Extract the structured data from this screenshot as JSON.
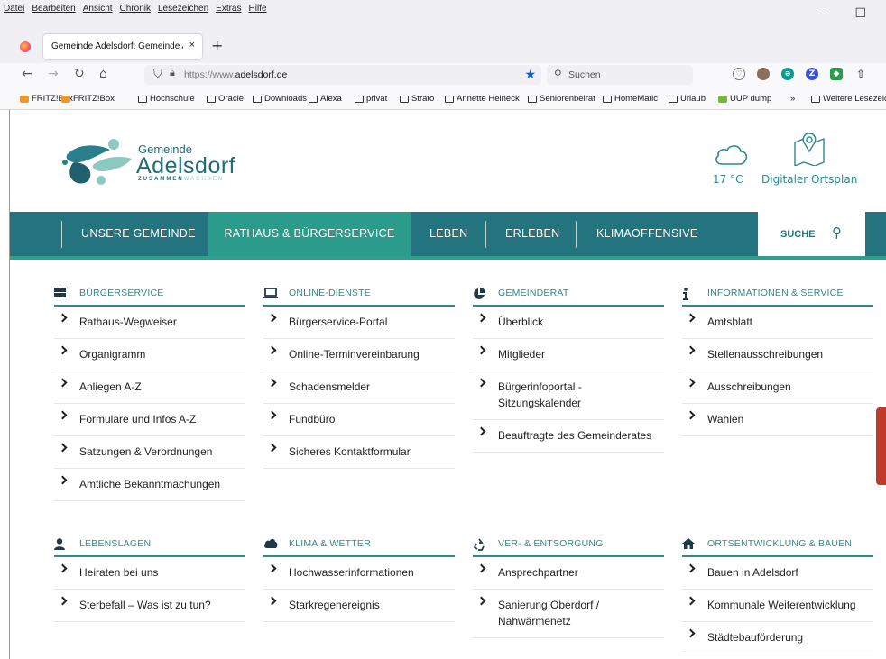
{
  "browser": {
    "menu": [
      "Datei",
      "Bearbeiten",
      "Ansicht",
      "Chronik",
      "Lesezeichen",
      "Extras",
      "Hilfe"
    ],
    "window_controls": [
      "–",
      "☐"
    ],
    "tab_title": "Gemeinde Adelsdorf: Gemeinde Adelsdorf",
    "tab_close": "×",
    "new_tab": "+",
    "url_prefix": "https://www.",
    "url_domain": "adelsdorf.de",
    "search_placeholder": "Suchen",
    "bookmarks": [
      "FRITZ!Box",
      "FRITZ!Box",
      "Hochschule",
      "Oracle",
      "Downloads",
      "Alexa",
      "privat",
      "Strato",
      "Annette Heineck",
      "Seniorenbeirat",
      "HomeMatic",
      "Urlaub",
      "UUP dump",
      "»",
      "Weitere Lesezeichen"
    ]
  },
  "site": {
    "logo": {
      "small": "Gemeinde",
      "big": "Adelsdorf",
      "tag1": "ZUSAMMEN",
      "tag2": "WACHSEN"
    },
    "weather": {
      "temp": "17 °C"
    },
    "ortsplan": "Digitaler Ortsplan",
    "nav": [
      "UNSERE GEMEINDE",
      "RATHAUS & BÜRGERSERVICE",
      "LEBEN",
      "ERLEBEN",
      "KLIMAOFFENSIVE"
    ],
    "search_label": "SUCHE"
  },
  "sections": [
    {
      "title": "BÜRGERSERVICE",
      "icon": "grid-icon",
      "items": [
        "Rathaus-Wegweiser",
        "Organigramm",
        "Anliegen A-Z",
        "Formulare und Infos A-Z",
        "Satzungen & Verordnungen",
        "Amtliche Bekanntmachungen"
      ]
    },
    {
      "title": "ONLINE-DIENSTE",
      "icon": "laptop-icon",
      "items": [
        "Bürgerservice-Portal",
        "Online-Terminvereinbarung",
        "Schadensmelder",
        "Fundbüro",
        "Sicheres Kontaktformular"
      ]
    },
    {
      "title": "GEMEINDERAT",
      "icon": "pie-chart-icon",
      "items": [
        "Überblick",
        "Mitglieder",
        "Bürgerinfoportal - Sitzungskalender",
        "Beauftragte des Gemeinderates"
      ]
    },
    {
      "title": "INFORMATIONEN & SERVICE",
      "icon": "info-icon",
      "items": [
        "Amtsblatt",
        "Stellenausschreibungen",
        "Ausschreibungen",
        "Wahlen"
      ]
    },
    {
      "title": "LEBENSLAGEN",
      "icon": "user-icon",
      "items": [
        "Heiraten bei uns",
        "Sterbefall – Was ist zu tun?"
      ]
    },
    {
      "title": "KLIMA & WETTER",
      "icon": "cloud-icon",
      "items": [
        "Hochwasserinformationen",
        "Starkregenereignis"
      ]
    },
    {
      "title": "VER- & ENTSORGUNG",
      "icon": "recycle-icon",
      "items": [
        "Ansprechpartner",
        "Sanierung Oberdorf / Nahwärmenetz"
      ]
    },
    {
      "title": "ORTSENTWICKLUNG & BAUEN",
      "icon": "home-icon",
      "items": [
        "Bauen in Adelsdorf",
        "Kommunale Weiterentwicklung",
        "Städtebauförderung"
      ]
    }
  ]
}
